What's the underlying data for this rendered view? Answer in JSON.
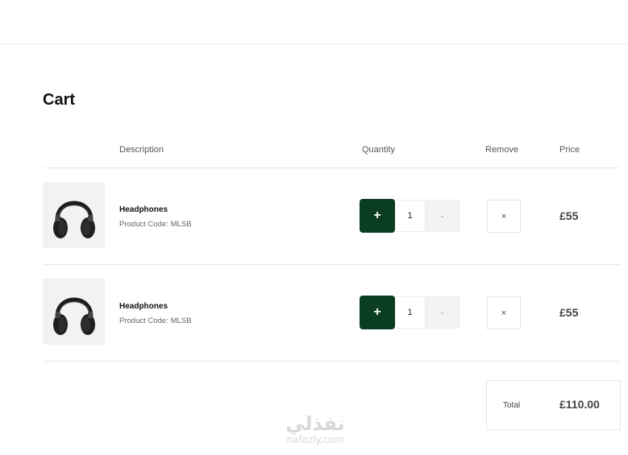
{
  "page": {
    "title": "Cart"
  },
  "columns": {
    "description": "Description",
    "quantity": "Quantity",
    "remove": "Remove",
    "price": "Price"
  },
  "items": [
    {
      "name": "Headphones",
      "code_label": "Product Code:",
      "code": "MLSB",
      "quantity": "1",
      "plus_label": "+",
      "minus_label": "-",
      "remove_label": "×",
      "price": "£55",
      "image_icon": "headphones-icon"
    },
    {
      "name": "Headphones",
      "code_label": "Product Code:",
      "code": "MLSB",
      "quantity": "1",
      "plus_label": "+",
      "minus_label": "-",
      "remove_label": "×",
      "price": "£55",
      "image_icon": "headphones-icon"
    }
  ],
  "summary": {
    "total_label": "Total",
    "total_value": "£110.00"
  },
  "watermark": {
    "arabic": "نفذلي",
    "latin": "nafezly.com"
  },
  "colors": {
    "accent": "#0b3d23",
    "divider": "#e6e6e6",
    "thumb_bg": "#f1f3f2"
  }
}
